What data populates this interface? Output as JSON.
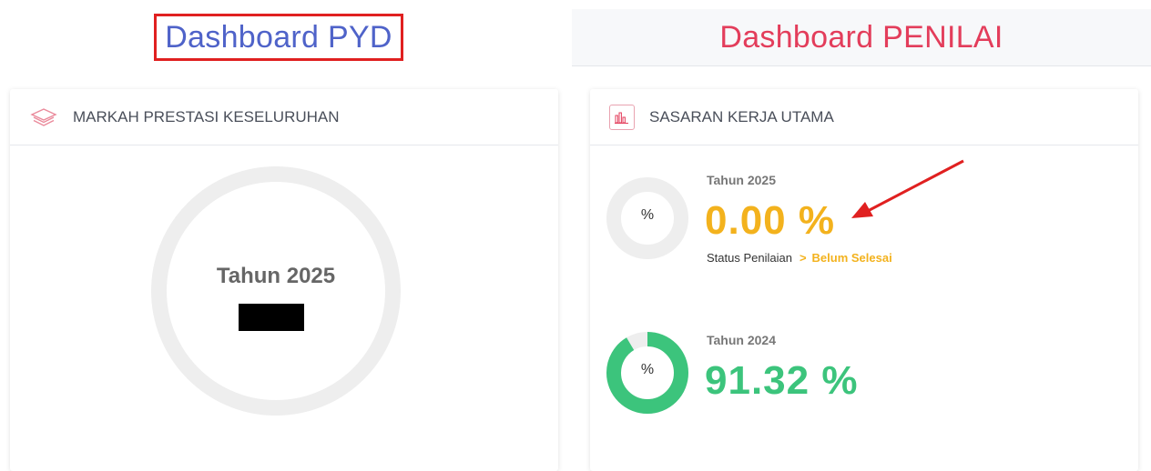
{
  "tabs": {
    "pyd_label": "Dashboard PYD",
    "penilai_label": "Dashboard PENILAI"
  },
  "markah": {
    "header_title": "MARKAH PRESTASI KESELURUHAN",
    "year_label": "Tahun 2025"
  },
  "sasaran": {
    "header_title": "SASARAN KERJA UTAMA",
    "entries": [
      {
        "year_label": "Tahun 2025",
        "ring_symbol": "%",
        "value": "0.00 %",
        "progress": 0.0,
        "color": "#f3b21d",
        "status_label": "Status Penilaian",
        "status_chevron": ">",
        "status_value": "Belum Selesai"
      },
      {
        "year_label": "Tahun 2024",
        "ring_symbol": "%",
        "value": "91.32 %",
        "progress": 0.9132,
        "color": "#3cc47c"
      }
    ]
  },
  "colors": {
    "pyd_title": "#4f63c9",
    "penilai_title": "#e33d5b",
    "highlight_border": "#e02020",
    "ring_track": "#eeeeee",
    "annotation_arrow": "#e02020"
  }
}
